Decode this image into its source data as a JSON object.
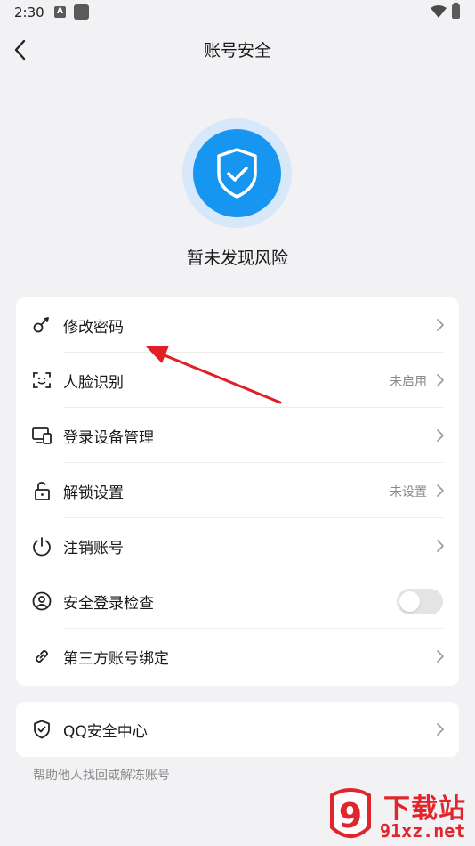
{
  "status_bar": {
    "time": "2:30",
    "a_badge": "A"
  },
  "header": {
    "title": "账号安全"
  },
  "security_status": {
    "text": "暂未发现风险",
    "accent": "#1696f0"
  },
  "menu": [
    {
      "label": "修改密码",
      "value": "",
      "icon": "key-icon"
    },
    {
      "label": "人脸识别",
      "value": "未启用",
      "icon": "face-scan-icon"
    },
    {
      "label": "登录设备管理",
      "value": "",
      "icon": "devices-icon"
    },
    {
      "label": "解锁设置",
      "value": "未设置",
      "icon": "unlock-icon"
    },
    {
      "label": "注销账号",
      "value": "",
      "icon": "power-icon"
    },
    {
      "label": "安全登录检查",
      "toggle": false,
      "icon": "user-circle-icon"
    },
    {
      "label": "第三方账号绑定",
      "value": "",
      "icon": "link-icon"
    }
  ],
  "qq_center": {
    "label": "QQ安全中心",
    "icon": "shield-check-icon"
  },
  "help_link": "帮助他人找回或解冻账号",
  "watermark": {
    "title": "下载站",
    "url": "91xz.net",
    "logo_text": "9"
  }
}
